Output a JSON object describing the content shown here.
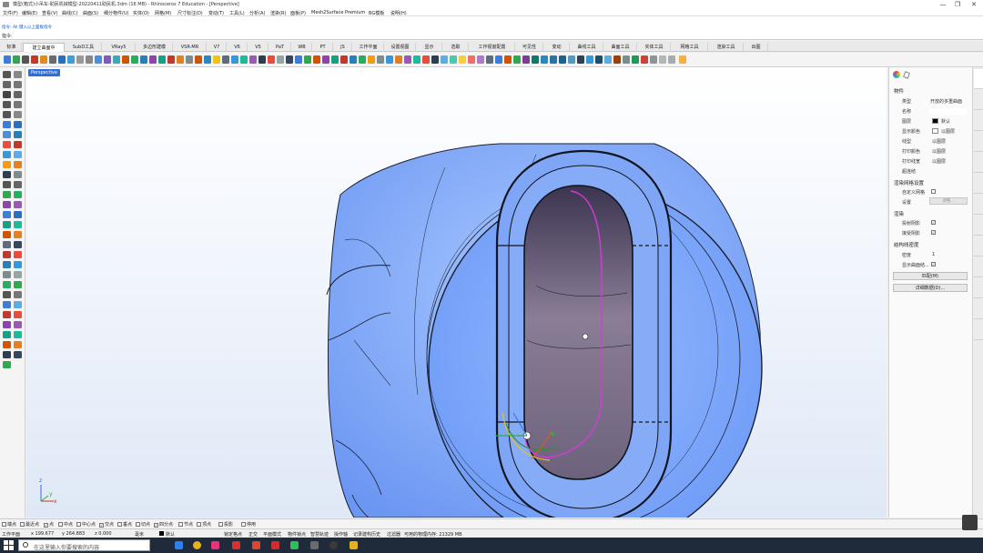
{
  "window": {
    "title": "模型(箱式)小吊车-助民机械模型-20220411助民机.3dm (16 MB) - Rhinoceros 7 Education - [Perspective]",
    "controls": [
      "—",
      "❐",
      "✕"
    ]
  },
  "menu": [
    "文件(F)",
    "编辑(E)",
    "查看(V)",
    "曲线(C)",
    "曲面(S)",
    "细分物件(U)",
    "实体(O)",
    "网格(M)",
    "尺寸标注(D)",
    "变动(T)",
    "工具(L)",
    "分析(A)",
    "渲染(R)",
    "面板(P)",
    "Mesh2Surface Premium",
    "BG模板",
    "说明(H)"
  ],
  "command": {
    "history": "指令: All  键入以上面板指令",
    "prompt": "指令:",
    "value": ""
  },
  "tabs": [
    "标准",
    "建立曲面中",
    "SubD工具",
    "VRay5",
    "多边形建模",
    "VSR-MR",
    "V7",
    "V6",
    "V5",
    "PaT",
    "WB",
    "PT",
    "JS",
    "工作平面",
    "设置视图",
    "显示",
    "选取",
    "工作视窗配置",
    "可见性",
    "变动",
    "曲线工具",
    "曲面工具",
    "实体工具",
    "网格工具",
    "渲染工具",
    "出图"
  ],
  "active_tab": "建立曲面中",
  "viewport": {
    "label": "Perspective",
    "axis_labels": {
      "z": "z",
      "y": "y",
      "x": "x"
    }
  },
  "properties": {
    "section_object": "物件",
    "rows": [
      {
        "label": "类型",
        "value": "开放的多重曲面"
      },
      {
        "label": "名称",
        "value": ""
      },
      {
        "label": "图层",
        "value": "默认"
      },
      {
        "label": "显示颜色",
        "value": "以图层"
      },
      {
        "label": "线型",
        "value": "以图层"
      },
      {
        "label": "打印颜色",
        "value": "以图层"
      },
      {
        "label": "打印线宽",
        "value": "以图层"
      },
      {
        "label": "超连结",
        "value": ""
      }
    ],
    "section_render_mesh": "渲染网格设置",
    "custom_mesh": "自定义网格",
    "settings_label": "设置",
    "settings_button": "调整...",
    "section_render": "渲染",
    "cast_shadows": "投射阴影",
    "receive_shadows": "接受阴影",
    "section_isocurve": "结构线密度",
    "density_label": "密度",
    "density_value": "1",
    "show_surface_isocurves": "显示曲面结...",
    "match_button": "匹配(M)",
    "details_button": "详细数据(D)..."
  },
  "osnap": [
    {
      "label": "端点",
      "checked": false
    },
    {
      "label": "最近点",
      "checked": false
    },
    {
      "label": "点",
      "checked": true
    },
    {
      "label": "中点",
      "checked": false
    },
    {
      "label": "中心点",
      "checked": false
    },
    {
      "label": "交点",
      "checked": true
    },
    {
      "label": "垂点",
      "checked": false
    },
    {
      "label": "切点",
      "checked": false
    },
    {
      "label": "四分点",
      "checked": true
    },
    {
      "label": "节点",
      "checked": false
    },
    {
      "label": "顶点",
      "checked": false
    },
    {
      "label": "投影",
      "checked": false
    },
    {
      "label": "停用",
      "checked": false
    }
  ],
  "status": {
    "cplane": "工作平面",
    "x": "x 199.677",
    "y": "y 264.883",
    "z": "z 0.000",
    "units": "毫米",
    "layer": "默认",
    "items": [
      "锁定格点",
      "正交",
      "平面模式",
      "物件锁点",
      "智慧轨迹",
      "操作轴",
      "记录建构历史",
      "过滤器",
      "可用的物理内存: 21329 MB"
    ]
  },
  "taskbar": {
    "search_placeholder": "在这里输入你要搜索的内容"
  }
}
